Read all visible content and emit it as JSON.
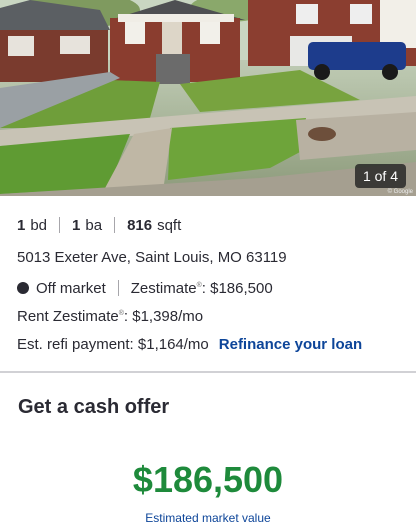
{
  "photo": {
    "counter": "1 of 4",
    "watermark": "© Google"
  },
  "facts": {
    "beds_value": "1",
    "beds_unit": "bd",
    "baths_value": "1",
    "baths_unit": "ba",
    "sqft_value": "816",
    "sqft_unit": "sqft",
    "address": "5013 Exeter Ave, Saint Louis, MO 63119",
    "status": "Off market",
    "zestimate_label": "Zestimate",
    "zestimate_value": ": $186,500",
    "rent_label": "Rent Zestimate",
    "rent_value": ": $1,398/mo",
    "refi_text": "Est. refi payment: $1,164/mo",
    "refi_link": "Refinance your loan",
    "reg_mark": "®"
  },
  "offer": {
    "title": "Get a cash offer",
    "amount": "$186,500",
    "subtitle": "Estimated market value"
  },
  "colors": {
    "accent_link": "#0d4599",
    "price_green": "#1e8a3b",
    "status_dot": "#2a2a33"
  }
}
